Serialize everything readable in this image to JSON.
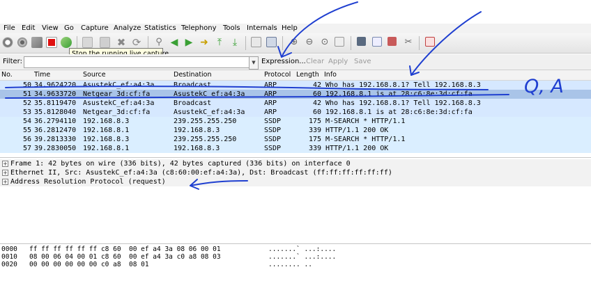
{
  "menu": [
    "File",
    "Edit",
    "View",
    "Go",
    "Capture",
    "Analyze",
    "Statistics",
    "Telephony",
    "Tools",
    "Internals",
    "Help"
  ],
  "toolbar": {
    "tooltip": "Stop the running live capture",
    "colors": {
      "stop": "#e01010",
      "green": "#3aa035",
      "blue": "#3a6fb0"
    }
  },
  "filter": {
    "label": "Filter:",
    "value": "",
    "expression": "Expression...",
    "clear": "Clear",
    "apply": "Apply",
    "save": "Save"
  },
  "packet_list": {
    "columns": [
      "No.",
      "Time",
      "Source",
      "Destination",
      "Protocol",
      "Length",
      "Info"
    ],
    "rows": [
      {
        "no": "50",
        "time": "34.9624220",
        "src": "AsustekC_ef:a4:3a",
        "dst": "Broadcast",
        "proto": "ARP",
        "len": "42",
        "info": "Who has 192.168.8.1?  Tell 192.168.8.3"
      },
      {
        "no": "51",
        "time": "34.9633720",
        "src": "Netgear_3d:cf:fa",
        "dst": "AsustekC_ef:a4:3a",
        "proto": "ARP",
        "len": "60",
        "info": "192.168.8.1 is at 28:c6:8e:3d:cf:fa"
      },
      {
        "no": "52",
        "time": "35.8119470",
        "src": "AsustekC_ef:a4:3a",
        "dst": "Broadcast",
        "proto": "ARP",
        "len": "42",
        "info": "Who has 192.168.8.1?  Tell 192.168.8.3"
      },
      {
        "no": "53",
        "time": "35.8128040",
        "src": "Netgear_3d:cf:fa",
        "dst": "AsustekC_ef:a4:3a",
        "proto": "ARP",
        "len": "60",
        "info": "192.168.8.1 is at 28:c6:8e:3d:cf:fa"
      },
      {
        "no": "54",
        "time": "36.2794110",
        "src": "192.168.8.3",
        "dst": "239.255.255.250",
        "proto": "SSDP",
        "len": "175",
        "info": "M-SEARCH * HTTP/1.1"
      },
      {
        "no": "55",
        "time": "36.2812470",
        "src": "192.168.8.1",
        "dst": "192.168.8.3",
        "proto": "SSDP",
        "len": "339",
        "info": "HTTP/1.1 200 OK"
      },
      {
        "no": "56",
        "time": "39.2813330",
        "src": "192.168.8.3",
        "dst": "239.255.255.250",
        "proto": "SSDP",
        "len": "175",
        "info": "M-SEARCH * HTTP/1.1"
      },
      {
        "no": "57",
        "time": "39.2830050",
        "src": "192.168.8.1",
        "dst": "192.168.8.3",
        "proto": "SSDP",
        "len": "339",
        "info": "HTTP/1.1 200 OK"
      }
    ]
  },
  "details": [
    "Frame 1: 42 bytes on wire (336 bits), 42 bytes captured (336 bits) on interface 0",
    "Ethernet II, Src: AsustekC_ef:a4:3a (c8:60:00:ef:a4:3a), Dst: Broadcast (ff:ff:ff:ff:ff:ff)",
    "Address Resolution Protocol (request)"
  ],
  "bytes": [
    {
      "offset": "0000",
      "hex": "ff ff ff ff ff ff c8 60  00 ef a4 3a 08 06 00 01",
      "ascii": ".......` ...:...."
    },
    {
      "offset": "0010",
      "hex": "08 00 06 04 00 01 c8 60  00 ef a4 3a c0 a8 08 03",
      "ascii": ".......` ...:...."
    },
    {
      "offset": "0020",
      "hex": "00 00 00 00 00 00 c0 a8  08 01",
      "ascii": "........ .."
    }
  ],
  "annotation_text": "Q, A"
}
